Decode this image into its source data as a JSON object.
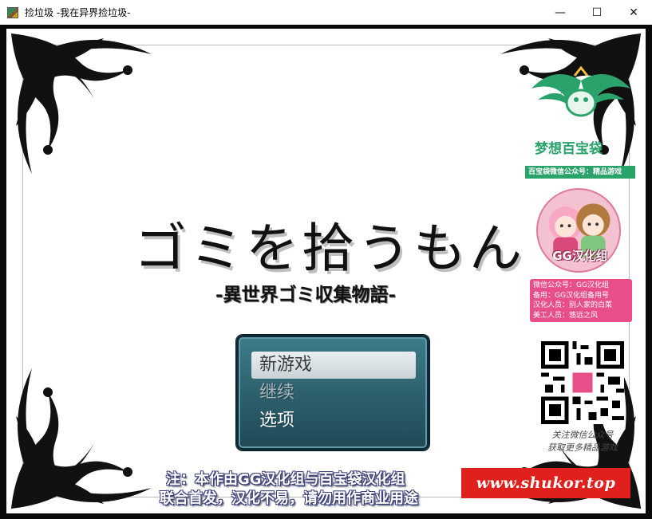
{
  "window": {
    "title": "捡垃圾 -我在异界捡垃圾-",
    "minimize": "—",
    "maximize": "☐",
    "close": "✕"
  },
  "game": {
    "title": "ゴミを拾うもん",
    "subtitle": "-異世界ゴミ収集物語-"
  },
  "menu": {
    "items": [
      {
        "label": "新游戏",
        "state": "selected"
      },
      {
        "label": "继续",
        "state": "disabled"
      },
      {
        "label": "选项",
        "state": "enabled"
      }
    ]
  },
  "credits": {
    "baibaodai_name": "梦想百宝袋",
    "baibaodai_bar": "百宝袋微信公众号：精品游戏",
    "gg_name": "GG汉化组",
    "gg_info": [
      "微信公众号：GG汉化组",
      "备用：GG汉化组备用号",
      "汉化人员：别人家的白菜",
      "美工人员：悠远之风"
    ],
    "qr_caption_1": "关注微信公众号",
    "qr_caption_2": "获取更多精品游戏"
  },
  "notice": {
    "line1": "注：本作由GG汉化组与百宝袋汉化组",
    "line2": "联合首发，汉化不易，请勿用作商业用途"
  },
  "watermark": "www.shukor.top",
  "colors": {
    "menu_bg": "#2c5e6b",
    "menu_border": "#0f2a36",
    "menu_selected": "#d9e1e4",
    "brand_green": "#2aa36b",
    "gg_pink": "#e84e8a",
    "watermark_red": "#e0201c"
  }
}
